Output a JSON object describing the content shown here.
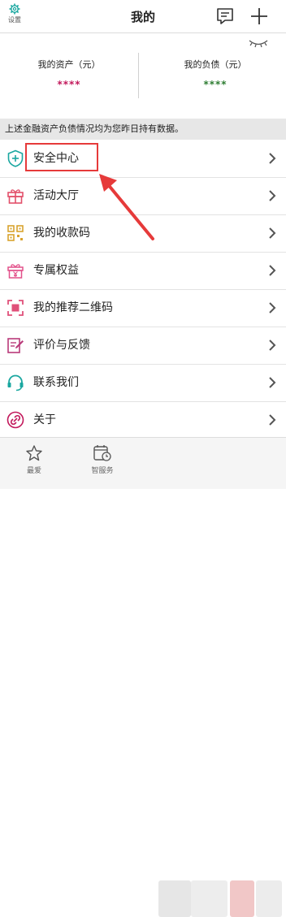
{
  "header": {
    "settings_label": "设置",
    "title": "我的"
  },
  "assets": {
    "left": {
      "label": "我的资产（元）",
      "value": "****",
      "color": "#c2185b"
    },
    "right": {
      "label": "我的负债（元）",
      "value": "****",
      "color": "#2e7d32"
    }
  },
  "notice": "上述金融资产负债情况均为您昨日持有数据。",
  "menu": [
    {
      "label": "安全中心",
      "icon": "shield-plus-icon"
    },
    {
      "label": "活动大厅",
      "icon": "gift-icon"
    },
    {
      "label": "我的收款码",
      "icon": "qr-code-icon"
    },
    {
      "label": "专属权益",
      "icon": "gift-yen-icon"
    },
    {
      "label": "我的推荐二维码",
      "icon": "scan-qr-icon"
    },
    {
      "label": "评价与反馈",
      "icon": "feedback-icon"
    },
    {
      "label": "联系我们",
      "icon": "headset-icon"
    },
    {
      "label": "关于",
      "icon": "link-icon"
    }
  ],
  "tabs": [
    {
      "label": "最爱",
      "icon": "star-icon"
    },
    {
      "label": "智服务",
      "icon": "calendar-clock-icon"
    }
  ],
  "colors": {
    "highlight": "#e63a3a",
    "accent": "#1aa7a0"
  }
}
